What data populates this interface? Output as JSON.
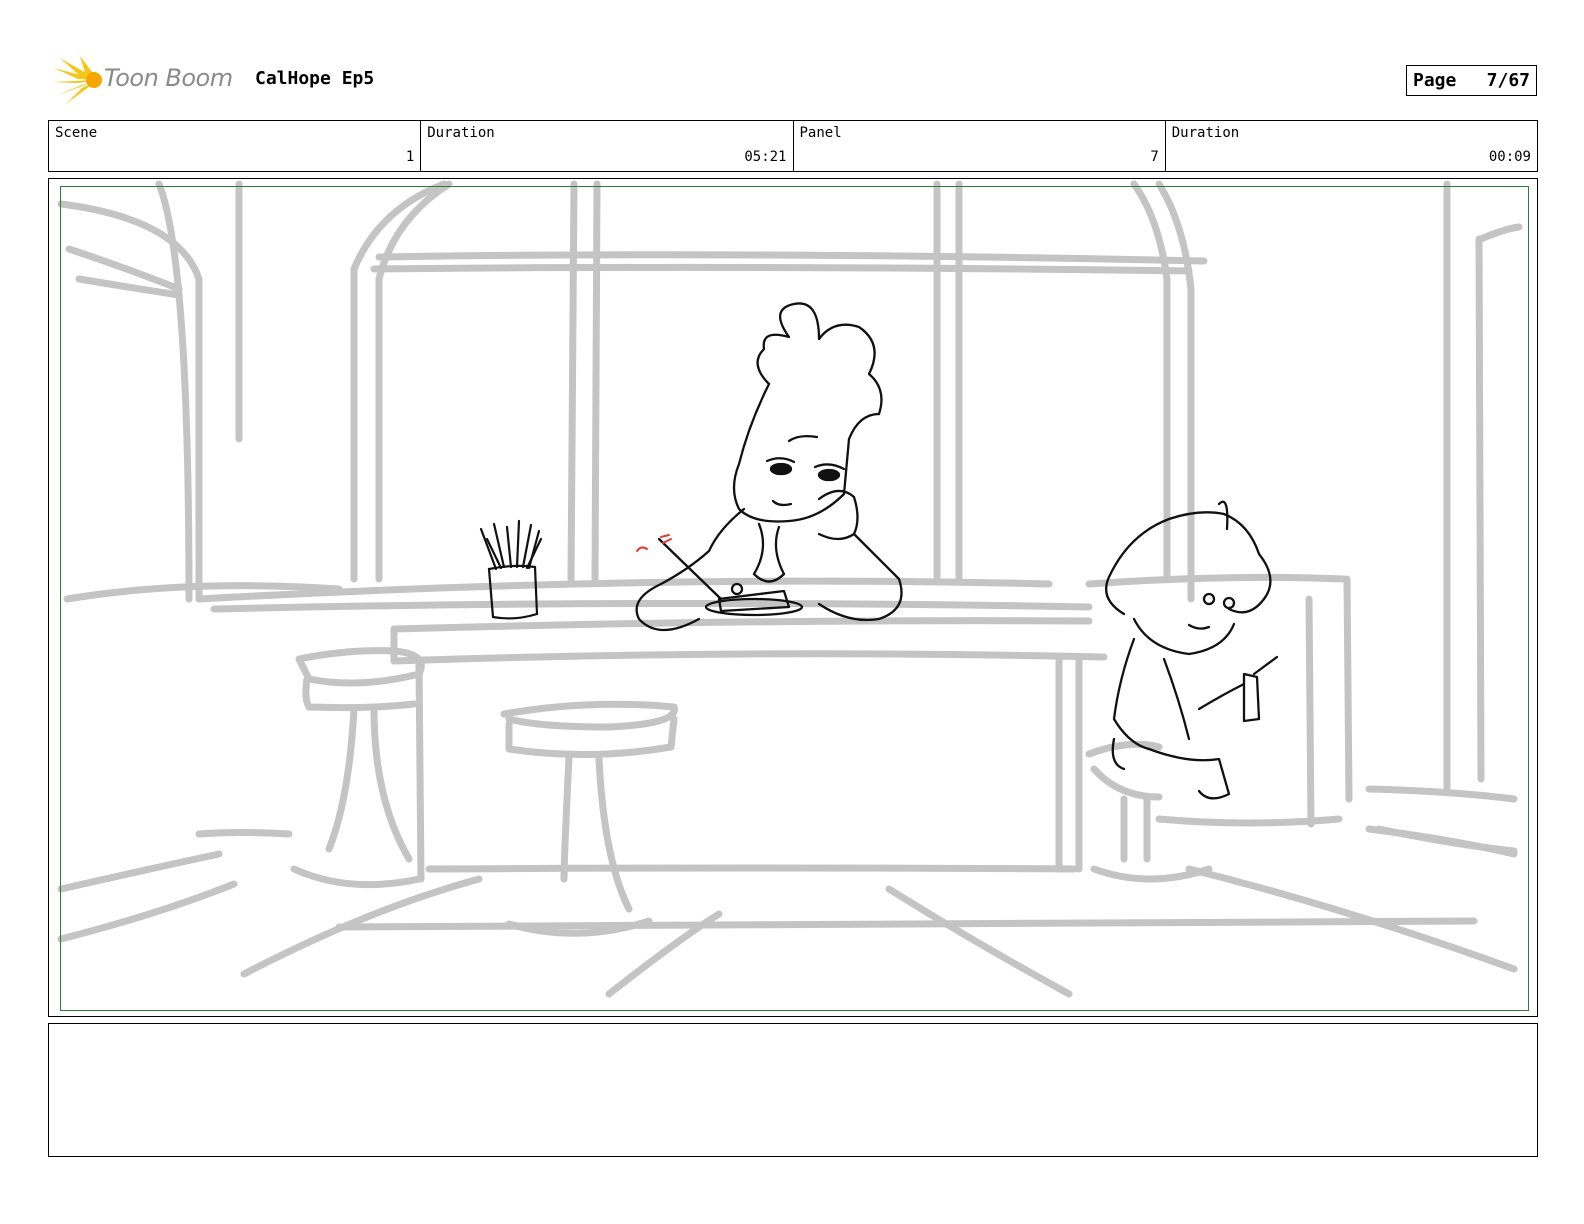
{
  "header": {
    "logo_text": "Toon Boom",
    "project_title": "CalHope Ep5",
    "page_label": "Page",
    "page_number": "7/67"
  },
  "info": {
    "scene_label": "Scene",
    "scene_value": "1",
    "scene_duration_label": "Duration",
    "scene_duration_value": "05:21",
    "panel_label": "Panel",
    "panel_value": "7",
    "panel_duration_label": "Duration",
    "panel_duration_value": "00:09"
  },
  "notes": {
    "text": ""
  },
  "colors": {
    "safe_area_border": "#2e7d32",
    "background_sketch": "#c4c4c4",
    "character_ink": "#111111",
    "logo_accent": "#f5c518",
    "annotation_red": "#e53935"
  }
}
